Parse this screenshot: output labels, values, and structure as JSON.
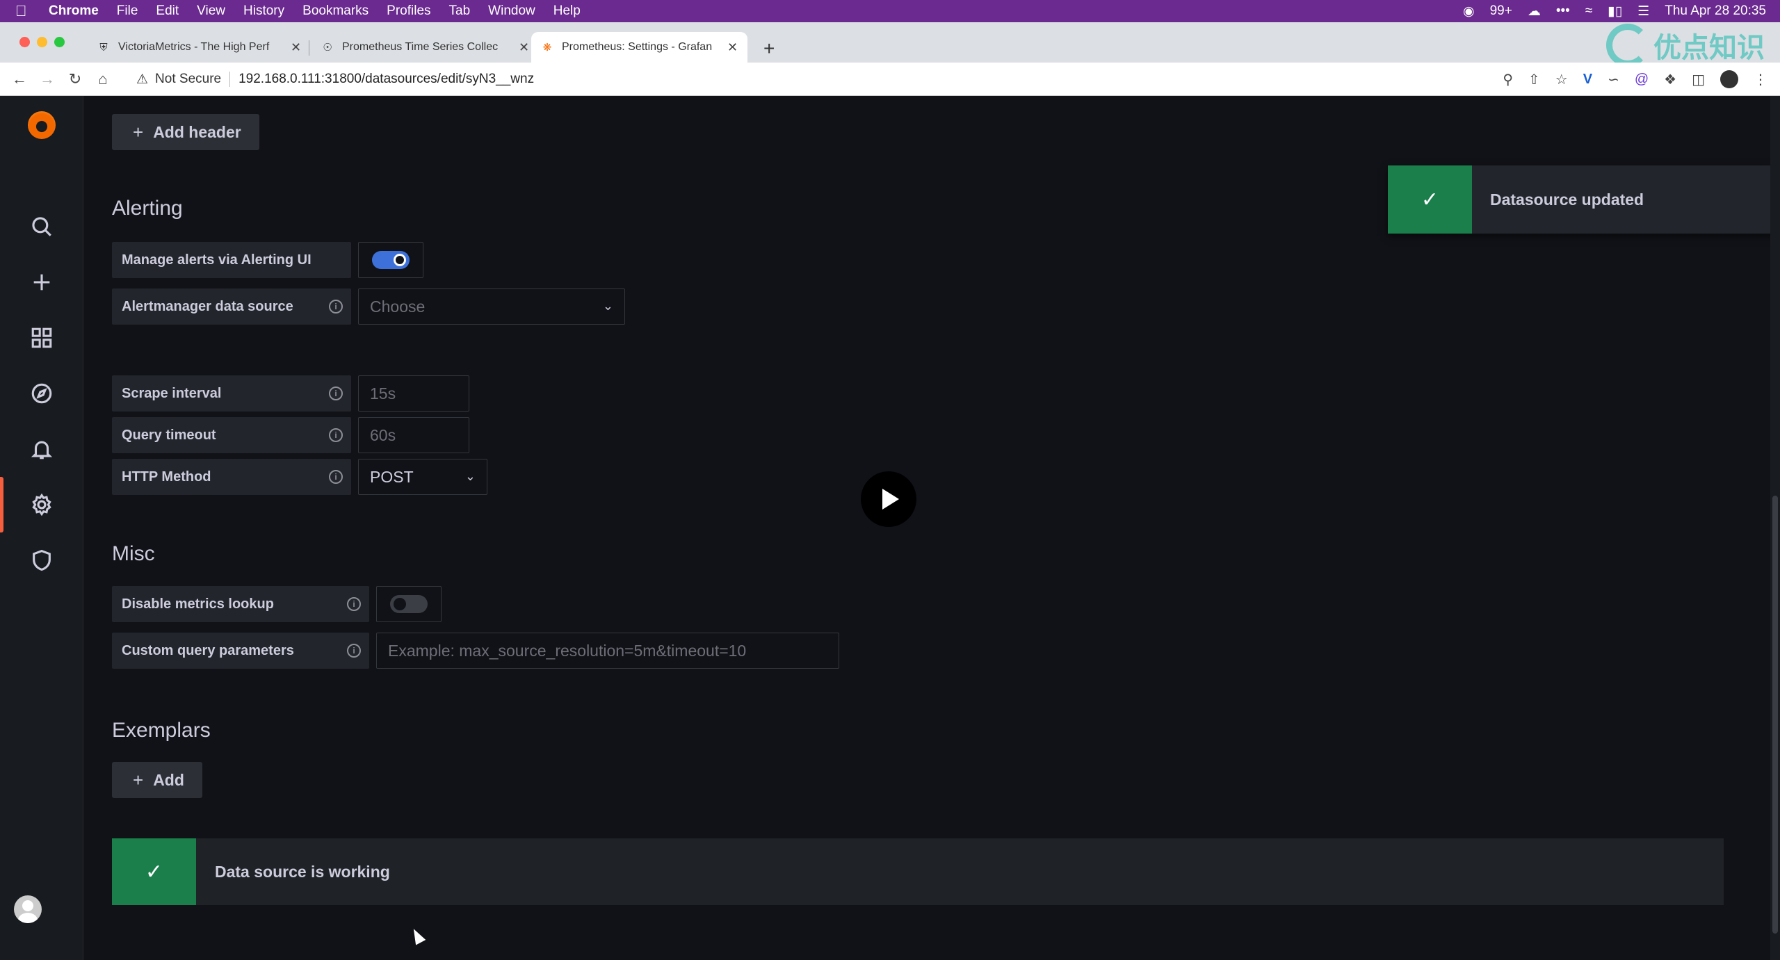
{
  "menubar": {
    "app": "Chrome",
    "items": [
      "File",
      "Edit",
      "View",
      "History",
      "Bookmarks",
      "Profiles",
      "Tab",
      "Window",
      "Help"
    ],
    "badge": "99+",
    "clock": "Thu Apr 28  20:35"
  },
  "tabs": [
    {
      "title": "VictoriaMetrics - The High Perf",
      "active": false
    },
    {
      "title": "Prometheus Time Series Collec",
      "active": false
    },
    {
      "title": "Prometheus: Settings - Grafan",
      "active": true
    }
  ],
  "watermark": "优点知识",
  "address": {
    "security": "Not Secure",
    "url": "192.168.0.111:31800/datasources/edit/syN3__wnz"
  },
  "headers": {
    "add_header_label": "Add header"
  },
  "alerting": {
    "title": "Alerting",
    "manage_label": "Manage alerts via Alerting UI",
    "manage_enabled": true,
    "alertmanager_label": "Alertmanager data source",
    "alertmanager_placeholder": "Choose"
  },
  "settings": {
    "scrape_label": "Scrape interval",
    "scrape_placeholder": "15s",
    "timeout_label": "Query timeout",
    "timeout_placeholder": "60s",
    "method_label": "HTTP Method",
    "method_value": "POST"
  },
  "misc": {
    "title": "Misc",
    "disable_lookup_label": "Disable metrics lookup",
    "disable_lookup_enabled": false,
    "custom_params_label": "Custom query parameters",
    "custom_params_placeholder": "Example: max_source_resolution=5m&timeout=10"
  },
  "exemplars": {
    "title": "Exemplars",
    "add_label": "Add"
  },
  "status": {
    "message": "Data source is working"
  },
  "toast": {
    "message": "Datasource updated"
  },
  "colors": {
    "success": "#1a7f4b",
    "accent": "#3d71d9",
    "active_marker": "#f55f3e"
  }
}
